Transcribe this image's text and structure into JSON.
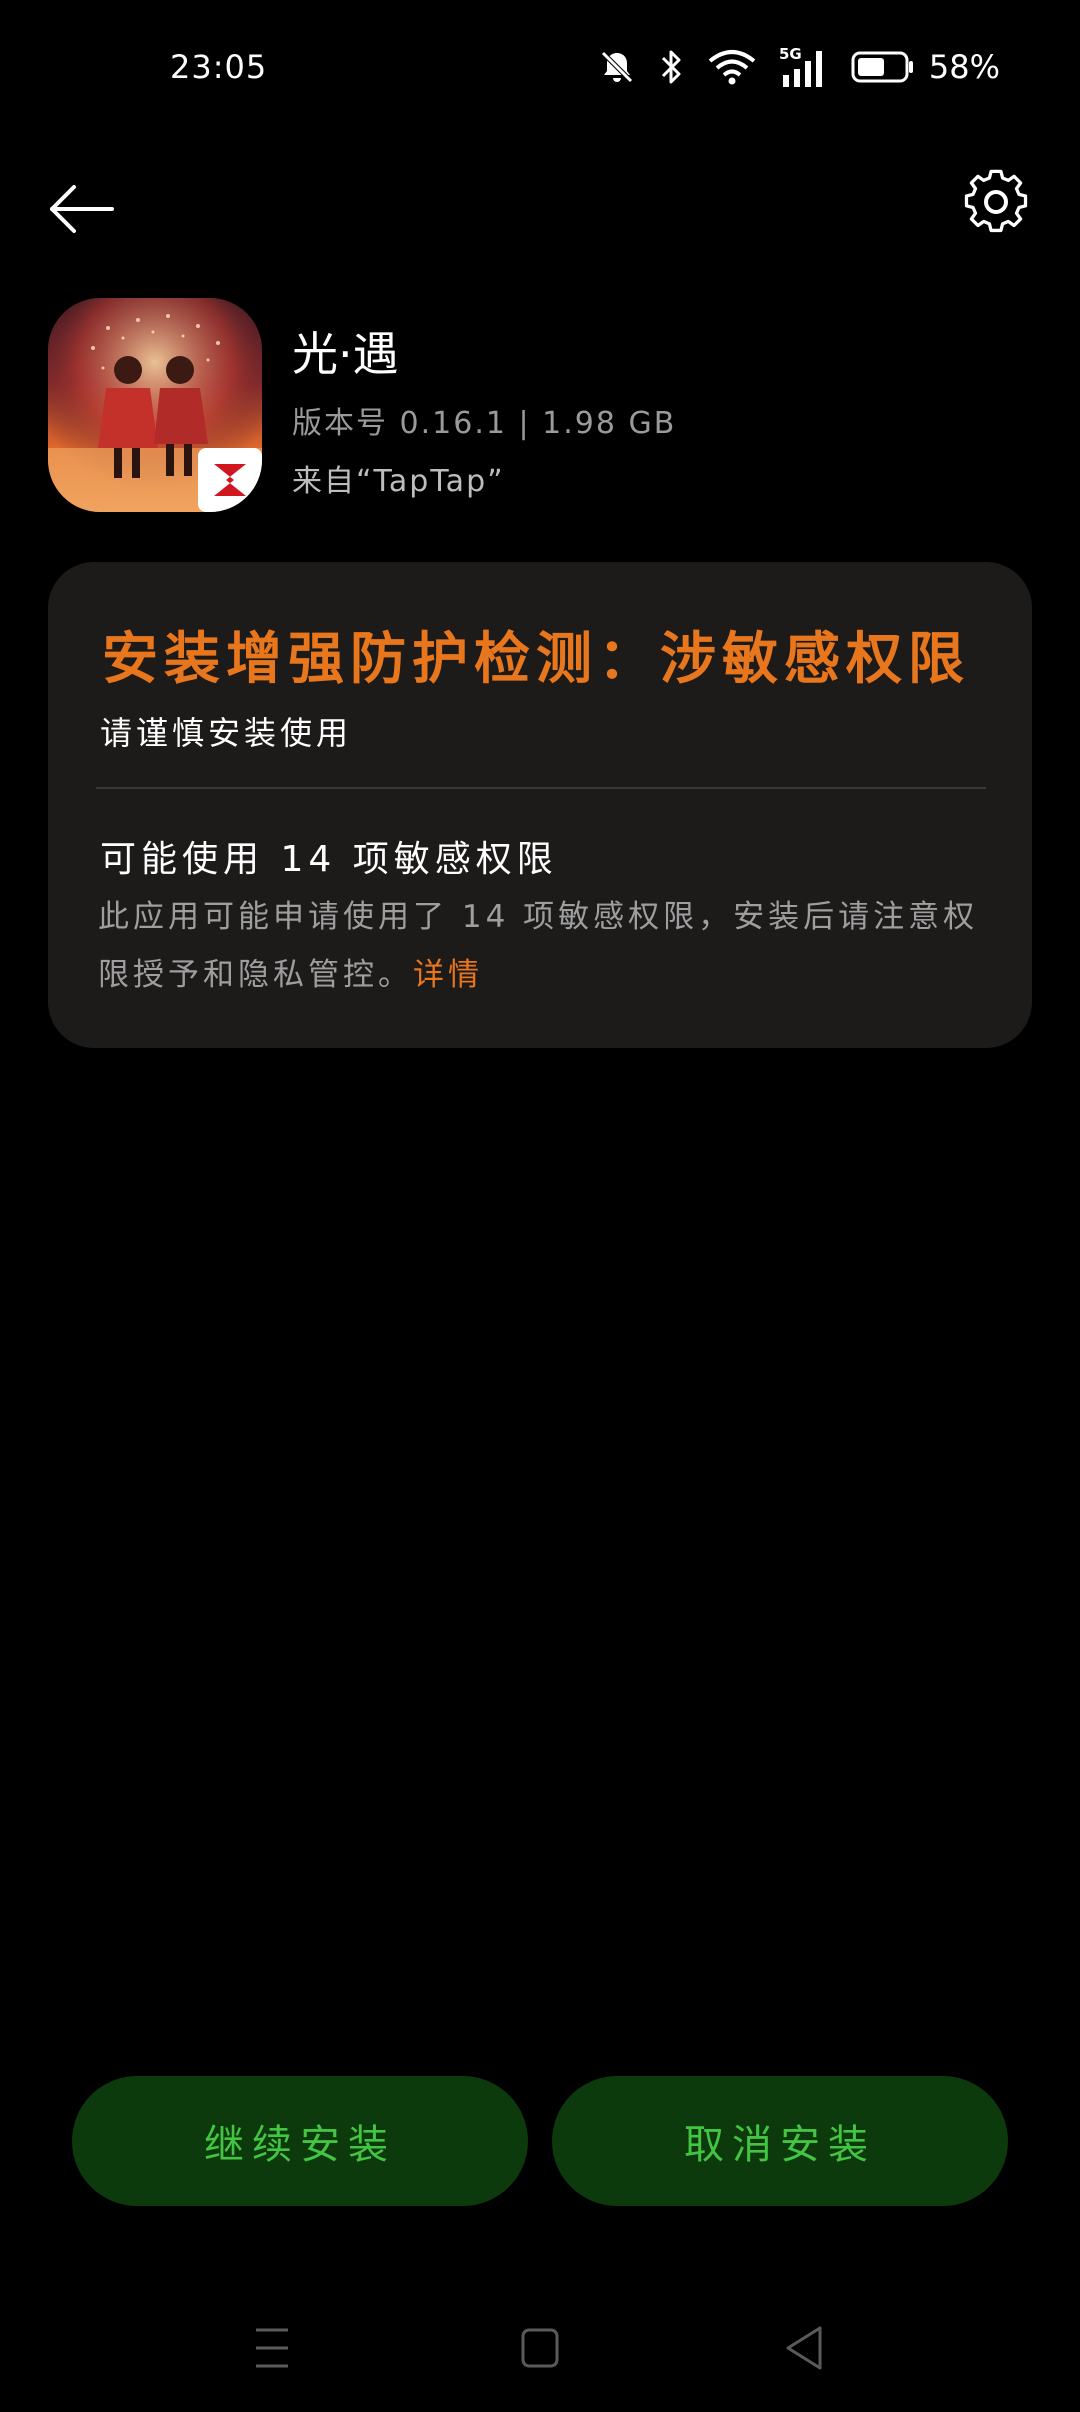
{
  "status_bar": {
    "time": "23:05",
    "network": "5G",
    "battery_percent": "58%",
    "battery_level": 0.58,
    "icons": [
      "mute-bell-icon",
      "bluetooth-icon",
      "wifi-icon",
      "cellular-signal-icon",
      "battery-icon"
    ]
  },
  "header": {
    "back_icon": "arrow-left-icon",
    "settings_icon": "gear-icon"
  },
  "app": {
    "name": "光·遇",
    "version_line": "版本号 0.16.1 | 1.98 GB",
    "source_line": "来自“TapTap”",
    "icon": "sky-children-of-light-app-icon"
  },
  "warning_card": {
    "title": "安装增强防护检测：涉敏感权限",
    "subtitle": "请谨慎安装使用",
    "permission_title": "可能使用 14 项敏感权限",
    "permission_description": "此应用可能申请使用了 14 项敏感权限，安装后请注意权限授予和隐私管控。",
    "details_link": "详情"
  },
  "buttons": {
    "continue_install": "继续安装",
    "cancel_install": "取消安装"
  },
  "nav_bar": {
    "icons": [
      "menu-icon",
      "home-icon",
      "back-triangle-icon"
    ]
  },
  "colors": {
    "background": "#000000",
    "card_background": "#1d1b1a",
    "warning_orange": "#e8761c",
    "button_background": "#0c3a0c",
    "button_text": "#43c443",
    "secondary_text": "#9e9e9e"
  }
}
